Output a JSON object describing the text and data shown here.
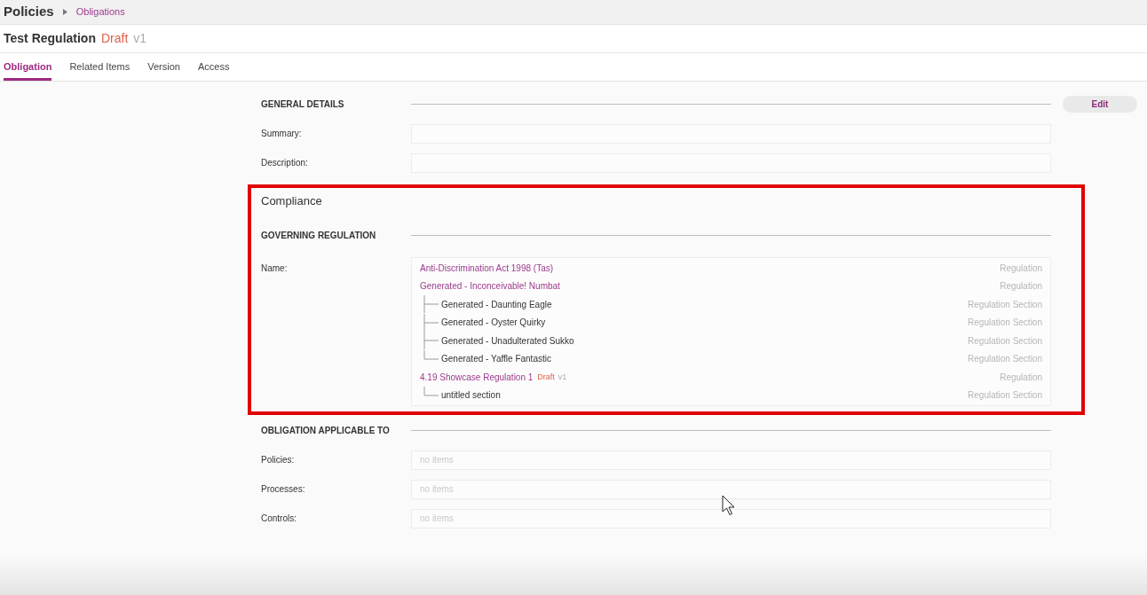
{
  "breadcrumb": {
    "root": "Policies",
    "current": "Obligations"
  },
  "record": {
    "title": "Test Regulation",
    "status": "Draft",
    "version": "v1"
  },
  "tabs": [
    {
      "label": "Obligation",
      "selected": true
    },
    {
      "label": "Related Items",
      "selected": false
    },
    {
      "label": "Version",
      "selected": false
    },
    {
      "label": "Access",
      "selected": false
    }
  ],
  "general_details": {
    "heading": "GENERAL DETAILS",
    "edit_button": "Edit",
    "fields": [
      {
        "label": "Summary:"
      },
      {
        "label": "Description:"
      }
    ]
  },
  "compliance": {
    "title": "Compliance",
    "highlighted": true,
    "heading": "GOVERNING REGULATION",
    "name_label": "Name:",
    "items": [
      {
        "name": "Anti-Discrimination Act 1998 (Tas)",
        "type": "Regulation"
      },
      {
        "name": "Generated - Inconceivable! Numbat",
        "type": "Regulation",
        "children": [
          {
            "name": "Generated - Daunting Eagle",
            "type": "Regulation Section"
          },
          {
            "name": "Generated - Oyster Quirky",
            "type": "Regulation Section"
          },
          {
            "name": "Generated - Unadulterated Sukko",
            "type": "Regulation Section"
          },
          {
            "name": "Generated - Yaffle Fantastic",
            "type": "Regulation Section"
          }
        ]
      },
      {
        "name": "4.19 Showcase Regulation 1",
        "status": "Draft",
        "version": "v1",
        "type": "Regulation",
        "children": [
          {
            "name": "untitled section",
            "type": "Regulation Section"
          }
        ]
      }
    ]
  },
  "applicable_to": {
    "heading": "OBLIGATION APPLICABLE TO",
    "fields": [
      {
        "label": "Policies:",
        "placeholder": "no items"
      },
      {
        "label": "Processes:",
        "placeholder": "no items"
      },
      {
        "label": "Controls:",
        "placeholder": "no items"
      }
    ]
  }
}
